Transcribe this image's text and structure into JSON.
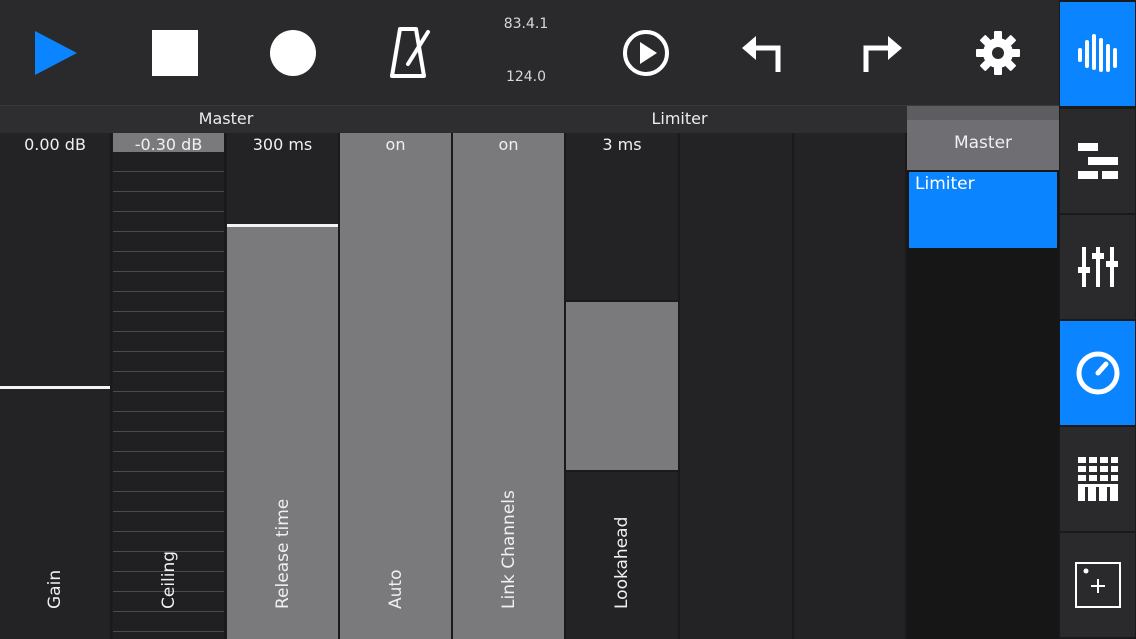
{
  "transport": {
    "position_time": "83.4.1",
    "tempo": "124.0"
  },
  "sections": {
    "master_label": "Master",
    "limiter_label": "Limiter"
  },
  "strips": [
    {
      "id": "gain",
      "value": "0.00 dB",
      "name": "Gain",
      "level": 0.5
    },
    {
      "id": "ceiling",
      "value": "-0.30 dB",
      "name": "Ceiling",
      "level": 0.96
    },
    {
      "id": "release",
      "value": "300 ms",
      "name": "Release time",
      "level": 0.82
    },
    {
      "id": "auto",
      "value": "on",
      "name": "Auto",
      "level": 1.0
    },
    {
      "id": "link",
      "value": "on",
      "name": "Link Channels",
      "level": 1.0
    },
    {
      "id": "lookahead",
      "value": "3 ms",
      "name": "Lookahead",
      "level": 0.67
    }
  ],
  "panel": {
    "master_item": "Master",
    "limiter_item": "Limiter"
  },
  "colors": {
    "accent": "#0a84ff",
    "background": "#1d1d1f",
    "fill": "#7a797c"
  },
  "icons": {
    "play": "play-icon",
    "stop": "stop-icon",
    "record": "record-icon",
    "metronome": "metronome-icon",
    "loop_play": "loop-play-icon",
    "undo": "undo-icon",
    "redo": "redo-icon",
    "settings": "gear-icon",
    "sidebar": [
      "waveform-icon",
      "arrangement-icon",
      "mixer-icon",
      "effects-dial-icon",
      "keyboard-grid-icon",
      "add-plugin-icon"
    ]
  }
}
